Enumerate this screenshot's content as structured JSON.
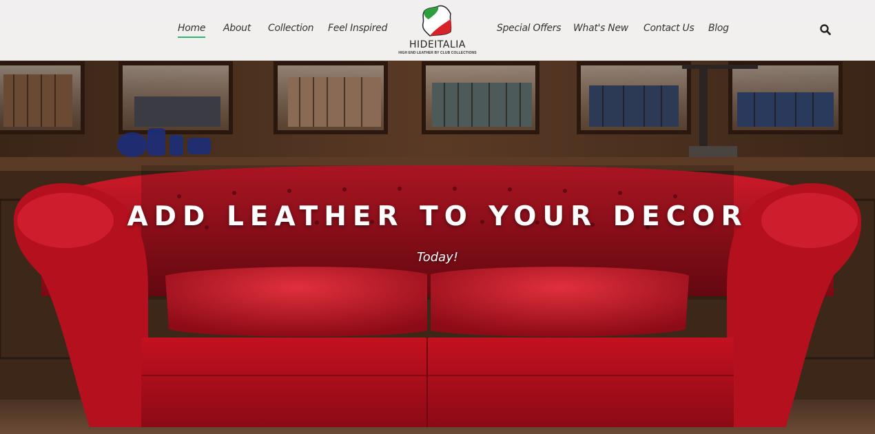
{
  "nav": {
    "left": [
      {
        "label": "Home",
        "active": true
      },
      {
        "label": "About"
      },
      {
        "label": "Collection"
      },
      {
        "label": "Feel Inspired"
      }
    ],
    "right": [
      {
        "label": "Special Offers"
      },
      {
        "label": "What's New"
      },
      {
        "label": "Contact Us"
      },
      {
        "label": "Blog"
      }
    ],
    "search_icon": "search-icon",
    "accent_color": "#2bb673"
  },
  "logo": {
    "name": "HIDEITALIA",
    "tagline": "HIGH END LEATHER BY CLUB COLLECTIONS",
    "flag_colors": [
      "#2e9e3e",
      "#ffffff",
      "#d8222a"
    ]
  },
  "hero": {
    "headline": "ADD LEATHER TO YOUR DECOR",
    "subline": "Today!",
    "sofa_color": "#b3101e"
  }
}
